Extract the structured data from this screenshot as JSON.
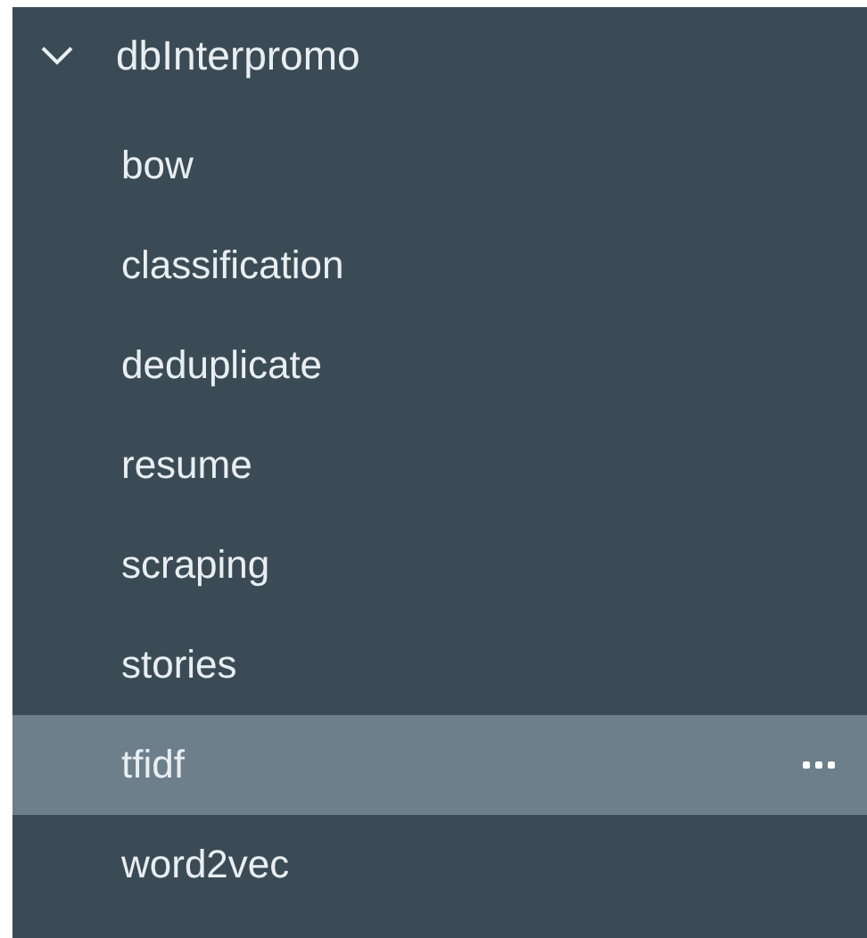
{
  "tree": {
    "label": "dbInterpromo",
    "expanded": true,
    "children": [
      {
        "label": "bow",
        "selected": false
      },
      {
        "label": "classification",
        "selected": false
      },
      {
        "label": "deduplicate",
        "selected": false
      },
      {
        "label": "resume",
        "selected": false
      },
      {
        "label": "scraping",
        "selected": false
      },
      {
        "label": "stories",
        "selected": false
      },
      {
        "label": "tfidf",
        "selected": true
      },
      {
        "label": "word2vec",
        "selected": false
      }
    ]
  }
}
